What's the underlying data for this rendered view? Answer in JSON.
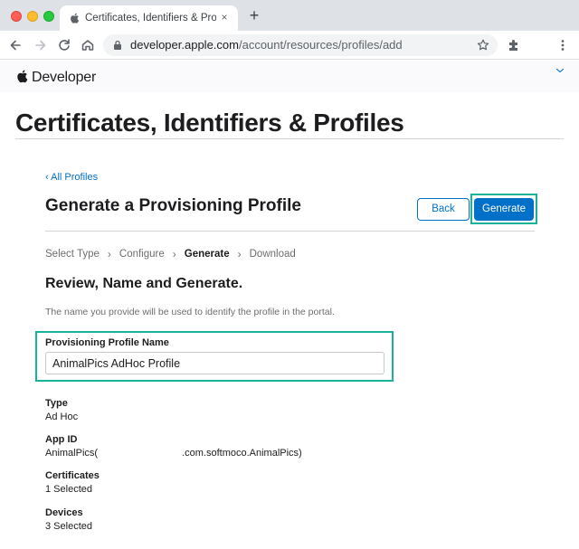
{
  "browser": {
    "tab_title": "Certificates, Identifiers & Profiles",
    "new_tab": "+",
    "tab_close": "×",
    "url_host": "developer.apple.com",
    "url_path": "/account/resources/profiles/add"
  },
  "header": {
    "brand": "Developer"
  },
  "page": {
    "title": "Certificates, Identifiers & Profiles"
  },
  "content": {
    "back_link": "‹ All Profiles",
    "section_title": "Generate a Provisioning Profile",
    "back_button": "Back",
    "generate_button": "Generate",
    "steps": [
      "Select Type",
      "Configure",
      "Generate",
      "Download"
    ],
    "active_step": "Generate",
    "review_title": "Review, Name and Generate.",
    "review_desc": "The name you provide will be used to identify the profile in the portal.",
    "name_label": "Provisioning Profile Name",
    "name_value": "AnimalPics AdHoc Profile",
    "info": {
      "type_label": "Type",
      "type_value": "Ad Hoc",
      "appid_label": "App ID",
      "appid_prefix": "AnimalPics(",
      "appid_suffix": ".com.softmoco.AnimalPics)",
      "certs_label": "Certificates",
      "certs_value": "1 Selected",
      "devices_label": "Devices",
      "devices_value": "3 Selected"
    }
  },
  "colors": {
    "accent": "#0070c9",
    "highlight": "#19b39a"
  }
}
